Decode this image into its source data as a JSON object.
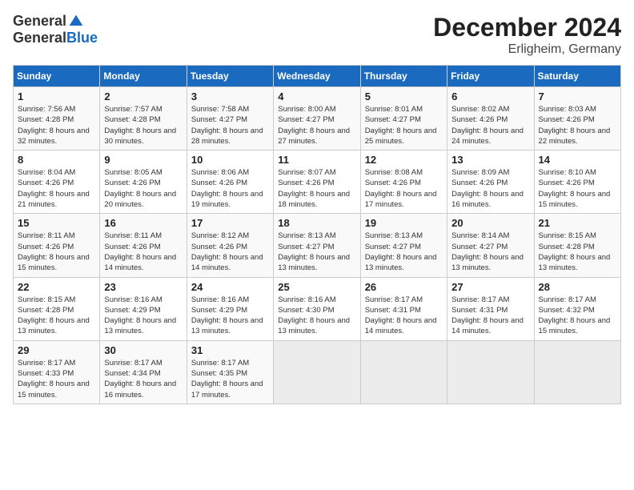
{
  "header": {
    "logo_general": "General",
    "logo_blue": "Blue",
    "title": "December 2024",
    "subtitle": "Erligheim, Germany"
  },
  "days_of_week": [
    "Sunday",
    "Monday",
    "Tuesday",
    "Wednesday",
    "Thursday",
    "Friday",
    "Saturday"
  ],
  "weeks": [
    [
      {
        "day": 1,
        "sunrise": "7:56 AM",
        "sunset": "4:28 PM",
        "daylight": "8 hours and 32 minutes."
      },
      {
        "day": 2,
        "sunrise": "7:57 AM",
        "sunset": "4:28 PM",
        "daylight": "8 hours and 30 minutes."
      },
      {
        "day": 3,
        "sunrise": "7:58 AM",
        "sunset": "4:27 PM",
        "daylight": "8 hours and 28 minutes."
      },
      {
        "day": 4,
        "sunrise": "8:00 AM",
        "sunset": "4:27 PM",
        "daylight": "8 hours and 27 minutes."
      },
      {
        "day": 5,
        "sunrise": "8:01 AM",
        "sunset": "4:27 PM",
        "daylight": "8 hours and 25 minutes."
      },
      {
        "day": 6,
        "sunrise": "8:02 AM",
        "sunset": "4:26 PM",
        "daylight": "8 hours and 24 minutes."
      },
      {
        "day": 7,
        "sunrise": "8:03 AM",
        "sunset": "4:26 PM",
        "daylight": "8 hours and 22 minutes."
      }
    ],
    [
      {
        "day": 8,
        "sunrise": "8:04 AM",
        "sunset": "4:26 PM",
        "daylight": "8 hours and 21 minutes."
      },
      {
        "day": 9,
        "sunrise": "8:05 AM",
        "sunset": "4:26 PM",
        "daylight": "8 hours and 20 minutes."
      },
      {
        "day": 10,
        "sunrise": "8:06 AM",
        "sunset": "4:26 PM",
        "daylight": "8 hours and 19 minutes."
      },
      {
        "day": 11,
        "sunrise": "8:07 AM",
        "sunset": "4:26 PM",
        "daylight": "8 hours and 18 minutes."
      },
      {
        "day": 12,
        "sunrise": "8:08 AM",
        "sunset": "4:26 PM",
        "daylight": "8 hours and 17 minutes."
      },
      {
        "day": 13,
        "sunrise": "8:09 AM",
        "sunset": "4:26 PM",
        "daylight": "8 hours and 16 minutes."
      },
      {
        "day": 14,
        "sunrise": "8:10 AM",
        "sunset": "4:26 PM",
        "daylight": "8 hours and 15 minutes."
      }
    ],
    [
      {
        "day": 15,
        "sunrise": "8:11 AM",
        "sunset": "4:26 PM",
        "daylight": "8 hours and 15 minutes."
      },
      {
        "day": 16,
        "sunrise": "8:11 AM",
        "sunset": "4:26 PM",
        "daylight": "8 hours and 14 minutes."
      },
      {
        "day": 17,
        "sunrise": "8:12 AM",
        "sunset": "4:26 PM",
        "daylight": "8 hours and 14 minutes."
      },
      {
        "day": 18,
        "sunrise": "8:13 AM",
        "sunset": "4:27 PM",
        "daylight": "8 hours and 13 minutes."
      },
      {
        "day": 19,
        "sunrise": "8:13 AM",
        "sunset": "4:27 PM",
        "daylight": "8 hours and 13 minutes."
      },
      {
        "day": 20,
        "sunrise": "8:14 AM",
        "sunset": "4:27 PM",
        "daylight": "8 hours and 13 minutes."
      },
      {
        "day": 21,
        "sunrise": "8:15 AM",
        "sunset": "4:28 PM",
        "daylight": "8 hours and 13 minutes."
      }
    ],
    [
      {
        "day": 22,
        "sunrise": "8:15 AM",
        "sunset": "4:28 PM",
        "daylight": "8 hours and 13 minutes."
      },
      {
        "day": 23,
        "sunrise": "8:16 AM",
        "sunset": "4:29 PM",
        "daylight": "8 hours and 13 minutes."
      },
      {
        "day": 24,
        "sunrise": "8:16 AM",
        "sunset": "4:29 PM",
        "daylight": "8 hours and 13 minutes."
      },
      {
        "day": 25,
        "sunrise": "8:16 AM",
        "sunset": "4:30 PM",
        "daylight": "8 hours and 13 minutes."
      },
      {
        "day": 26,
        "sunrise": "8:17 AM",
        "sunset": "4:31 PM",
        "daylight": "8 hours and 14 minutes."
      },
      {
        "day": 27,
        "sunrise": "8:17 AM",
        "sunset": "4:31 PM",
        "daylight": "8 hours and 14 minutes."
      },
      {
        "day": 28,
        "sunrise": "8:17 AM",
        "sunset": "4:32 PM",
        "daylight": "8 hours and 15 minutes."
      }
    ],
    [
      {
        "day": 29,
        "sunrise": "8:17 AM",
        "sunset": "4:33 PM",
        "daylight": "8 hours and 15 minutes."
      },
      {
        "day": 30,
        "sunrise": "8:17 AM",
        "sunset": "4:34 PM",
        "daylight": "8 hours and 16 minutes."
      },
      {
        "day": 31,
        "sunrise": "8:17 AM",
        "sunset": "4:35 PM",
        "daylight": "8 hours and 17 minutes."
      },
      null,
      null,
      null,
      null
    ]
  ]
}
